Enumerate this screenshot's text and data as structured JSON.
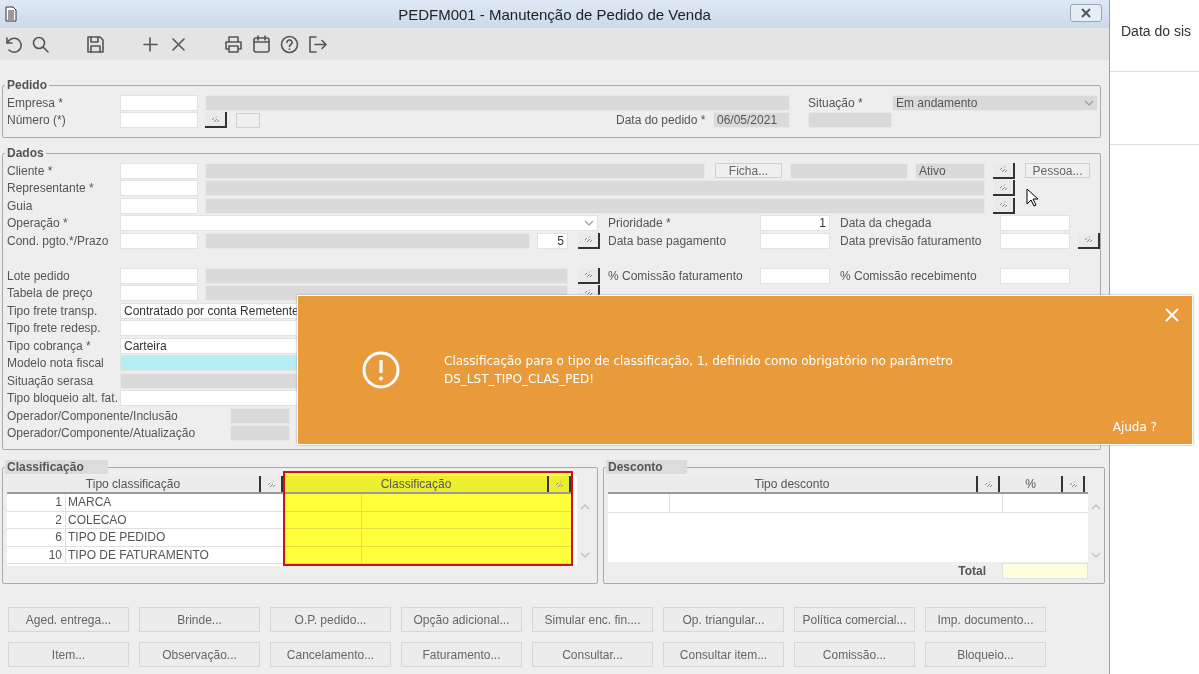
{
  "window": {
    "title": "PEDFM001 - Manutenção de Pedido de Venda"
  },
  "side_panel": {
    "heading": "Data do sis"
  },
  "pedido": {
    "title": "Pedido",
    "rows": [
      [
        {
          "kind": "label",
          "text": "Empresa *"
        },
        {
          "kind": "field",
          "disabled": false,
          "highlighted": false
        },
        {
          "kind": "field",
          "disabled": true,
          "highlighted": false
        },
        {
          "kind": "label",
          "text": "Situação *"
        },
        {
          "kind": "select",
          "value": "Em andamento",
          "disabled": true
        }
      ],
      [
        {
          "kind": "label",
          "text": "Número (*)"
        },
        {
          "kind": "field",
          "disabled": false,
          "highlighted": false
        },
        {
          "kind": "lookup"
        },
        {
          "kind": "button"
        },
        {
          "kind": "label",
          "text": "Data do pedido *"
        },
        {
          "kind": "field",
          "value": "06/05/2021",
          "disabled": true,
          "highlighted": false
        },
        {
          "kind": "field",
          "disabled": true,
          "highlighted": false
        }
      ]
    ]
  },
  "dados": {
    "title": "Dados",
    "rows": [
      {
        "items": [
          {
            "kind": "label",
            "text": "Cliente *"
          },
          {
            "kind": "field",
            "disabled": false,
            "highlighted": false
          },
          {
            "kind": "field",
            "disabled": true,
            "highlighted": false
          },
          {
            "kind": "button",
            "text": "Ficha..."
          },
          {
            "kind": "field",
            "disabled": true,
            "highlighted": false
          },
          {
            "kind": "field",
            "value": "Ativo",
            "disabled": true,
            "highlighted": false
          },
          {
            "kind": "lookup"
          },
          {
            "kind": "button",
            "text": "Pessoa..."
          }
        ]
      },
      {
        "items": [
          {
            "kind": "label",
            "text": "Representante *"
          },
          {
            "kind": "field",
            "disabled": false,
            "highlighted": false
          },
          {
            "kind": "field",
            "disabled": true,
            "highlighted": false
          },
          {
            "kind": "lookup"
          }
        ]
      },
      {
        "items": [
          {
            "kind": "label",
            "text": "Guia"
          },
          {
            "kind": "field",
            "disabled": false,
            "highlighted": false
          },
          {
            "kind": "field",
            "disabled": true,
            "highlighted": false
          },
          {
            "kind": "lookup"
          }
        ]
      },
      {
        "items": [
          {
            "kind": "label",
            "text": "Operação *"
          },
          {
            "kind": "select",
            "disabled": false
          },
          {
            "kind": "label",
            "text": "Prioridade *"
          },
          {
            "kind": "number",
            "value": "1",
            "disabled": false,
            "highlighted": false
          },
          {
            "kind": "label",
            "text": "Data da chegada"
          },
          {
            "kind": "field",
            "disabled": false,
            "highlighted": false
          }
        ]
      },
      {
        "items": [
          {
            "kind": "label",
            "text": "Cond. pgto.*/Prazo"
          },
          {
            "kind": "field",
            "disabled": false,
            "highlighted": false
          },
          {
            "kind": "field",
            "disabled": true,
            "highlighted": false
          },
          {
            "kind": "number",
            "value": "5",
            "disabled": false,
            "highlighted": false
          },
          {
            "kind": "lookup"
          },
          {
            "kind": "label",
            "text": "Data base pagamento"
          },
          {
            "kind": "field",
            "disabled": false,
            "highlighted": false
          },
          {
            "kind": "label",
            "text": "Data previsão faturamento"
          },
          {
            "kind": "field",
            "disabled": false,
            "highlighted": false
          },
          {
            "kind": "lookup"
          }
        ]
      },
      {
        "items": [
          {
            "kind": "label",
            "text": "Lote pedido"
          },
          {
            "kind": "field",
            "disabled": false,
            "highlighted": false
          },
          {
            "kind": "field",
            "disabled": true,
            "highlighted": false
          },
          {
            "kind": "lookup"
          },
          {
            "kind": "label",
            "text": "% Comissão faturamento"
          },
          {
            "kind": "field",
            "disabled": false,
            "highlighted": false
          },
          {
            "kind": "label",
            "text": "% Comissão recebimento"
          },
          {
            "kind": "field",
            "disabled": false,
            "highlighted": false
          }
        ]
      },
      {
        "items": [
          {
            "kind": "label",
            "text": "Tabela de preço"
          },
          {
            "kind": "field",
            "disabled": false,
            "highlighted": false
          },
          {
            "kind": "field",
            "disabled": true,
            "highlighted": false
          },
          {
            "kind": "lookup"
          }
        ]
      },
      {
        "items": [
          {
            "kind": "label",
            "text": "Tipo frete transp."
          },
          {
            "kind": "field",
            "value": "Contratado por conta Remetente",
            "disabled": false,
            "highlighted": false
          }
        ]
      },
      {
        "items": [
          {
            "kind": "label",
            "text": "Tipo frete redesp."
          },
          {
            "kind": "field",
            "disabled": false,
            "highlighted": false
          }
        ]
      },
      {
        "items": [
          {
            "kind": "label",
            "text": "Tipo cobrança *"
          },
          {
            "kind": "field",
            "value": "Carteira",
            "disabled": false,
            "highlighted": false
          }
        ]
      },
      {
        "items": [
          {
            "kind": "label",
            "text": "Modelo nota fiscal"
          },
          {
            "kind": "field",
            "disabled": false,
            "highlighted": true
          }
        ]
      },
      {
        "items": [
          {
            "kind": "label",
            "text": "Situação serasa"
          },
          {
            "kind": "field",
            "disabled": true,
            "highlighted": false
          }
        ]
      },
      {
        "items": [
          {
            "kind": "label",
            "text": "Tipo bloqueio alt. fat."
          },
          {
            "kind": "field",
            "disabled": false,
            "highlighted": false
          }
        ]
      },
      {
        "items": [
          {
            "kind": "label",
            "text": "Operador/Componente/Inclusão"
          },
          {
            "kind": "field",
            "disabled": true,
            "highlighted": false
          }
        ]
      },
      {
        "items": [
          {
            "kind": "label",
            "text": "Operador/Componente/Atualização"
          },
          {
            "kind": "field",
            "disabled": true,
            "highlighted": false
          }
        ]
      }
    ]
  },
  "classificacao": {
    "title": "Classificação",
    "columns": [
      {
        "label": "Tipo classificação",
        "highlighted": false
      },
      {
        "label": "Classificação",
        "highlighted": true
      }
    ],
    "rows": [
      {
        "number": "1",
        "name": "MARCA"
      },
      {
        "number": "2",
        "name": "COLECAO"
      },
      {
        "number": "6",
        "name": "TIPO DE PEDIDO"
      },
      {
        "number": "10",
        "name": "TIPO DE FATURAMENTO"
      }
    ]
  },
  "desconto": {
    "title": "Desconto",
    "columns": [
      {
        "label": "Tipo desconto"
      },
      {
        "label": "%"
      }
    ],
    "total_label": "Total"
  },
  "buttons": [
    [
      "Aged. entrega...",
      "Brinde...",
      "O.P. pedido...",
      "Opção adicional...",
      "Simular enc. fin....",
      "Op. triangular...",
      "Política comercial...",
      "Imp. documento..."
    ],
    [
      "Item...",
      "Observação...",
      "Cancelamento...",
      "Faturamento...",
      "Consultar...",
      "Consultar item...",
      "Comissão...",
      "Bloqueio..."
    ]
  ],
  "toast": {
    "message": "Classificação para o tipo de classificação, 1, definido como obrigatório no parâmetro DS_LST_TIPO_CLAS_PED!",
    "help": "Ajuda ?"
  }
}
